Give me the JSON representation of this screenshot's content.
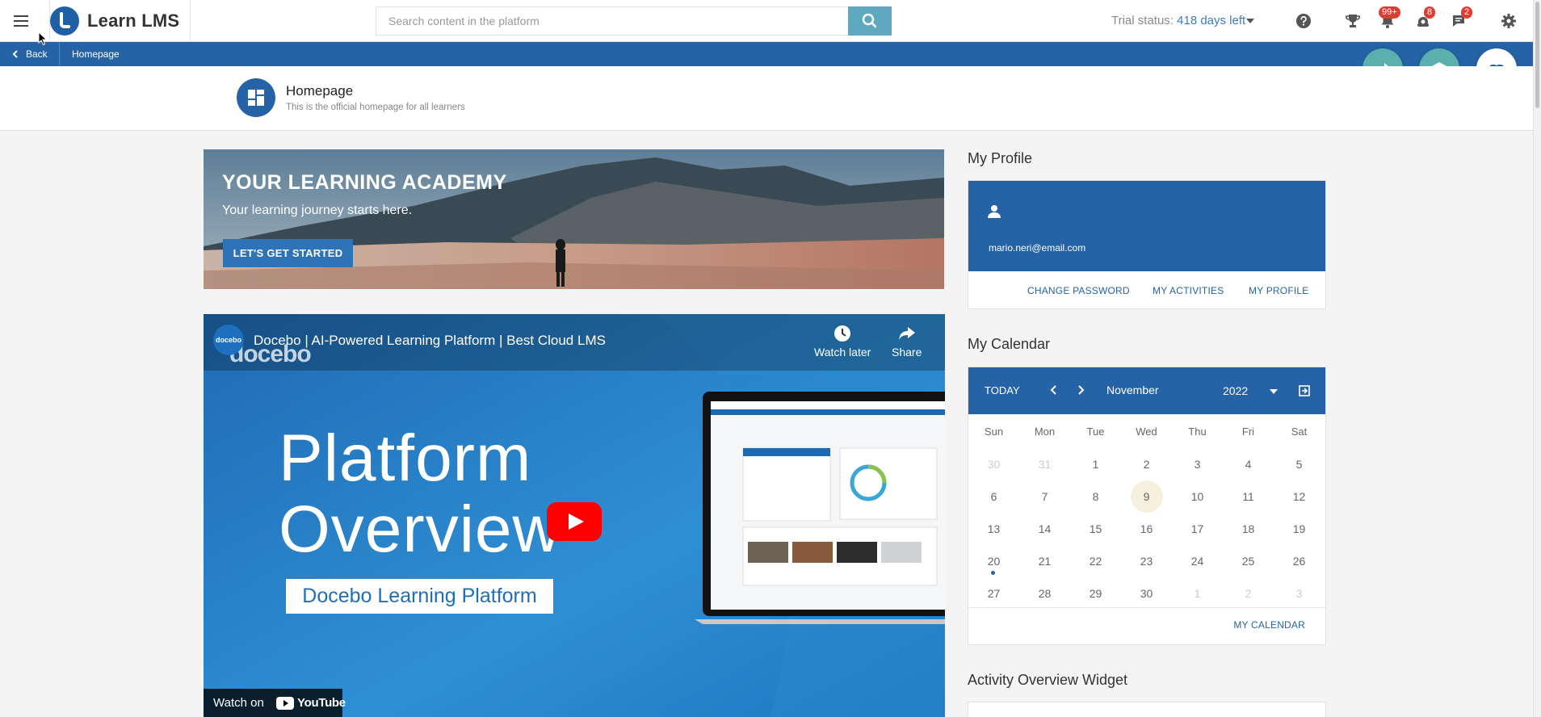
{
  "app": {
    "brand": "Learn LMS"
  },
  "header": {
    "search_placeholder": "Search content in the platform",
    "trial_label": "Trial status:",
    "trial_value": "418 days left",
    "badges": {
      "notifications": "99+",
      "gamification": "8",
      "messages": "2"
    },
    "icons": [
      "menu-icon",
      "search-icon",
      "help-icon",
      "trophy-icon",
      "bell-icon",
      "medal-icon",
      "chat-icon",
      "gear-icon"
    ]
  },
  "breadcrumb": {
    "back": "Back",
    "current": "Homepage"
  },
  "page": {
    "title": "Homepage",
    "subtitle": "This is the official homepage for all learners"
  },
  "banner": {
    "title": "YOUR LEARNING ACADEMY",
    "subtitle": "Your learning journey starts here.",
    "button": "LET'S GET STARTED"
  },
  "video": {
    "channel": "docebo",
    "title": "Docebo | AI-Powered Learning Platform | Best Cloud LMS",
    "watermark": "docebo",
    "watch_later": "Watch later",
    "share": "Share",
    "headline_1": "Platform",
    "headline_2": "Overview",
    "pill": "Docebo Learning Platform",
    "watch_on": "Watch on",
    "youtube": "YouTube"
  },
  "profile": {
    "section_title": "My Profile",
    "email": "mario.neri@email.com",
    "links": [
      "CHANGE PASSWORD",
      "MY ACTIVITIES",
      "MY PROFILE"
    ]
  },
  "calendar": {
    "section_title": "My Calendar",
    "today": "TODAY",
    "month": "November",
    "year": "2022",
    "days_of_week": [
      "Sun",
      "Mon",
      "Tue",
      "Wed",
      "Thu",
      "Fri",
      "Sat"
    ],
    "weeks": [
      [
        "30",
        "31",
        "1",
        "2",
        "3",
        "4",
        "5"
      ],
      [
        "6",
        "7",
        "8",
        "9",
        "10",
        "11",
        "12"
      ],
      [
        "13",
        "14",
        "15",
        "16",
        "17",
        "18",
        "19"
      ],
      [
        "20",
        "21",
        "22",
        "23",
        "24",
        "25",
        "26"
      ],
      [
        "27",
        "28",
        "29",
        "30",
        "1",
        "2",
        "3"
      ]
    ],
    "selected_day": "9",
    "event_day": "20",
    "link": "MY CALENDAR"
  },
  "activity": {
    "section_title": "Activity Overview Widget"
  },
  "colors": {
    "primary": "#2563a6",
    "search_button": "#5fa9c0",
    "fab_teal": "#5bb0ad",
    "badge": "#e03c31",
    "youtube_red": "#ff0000"
  }
}
